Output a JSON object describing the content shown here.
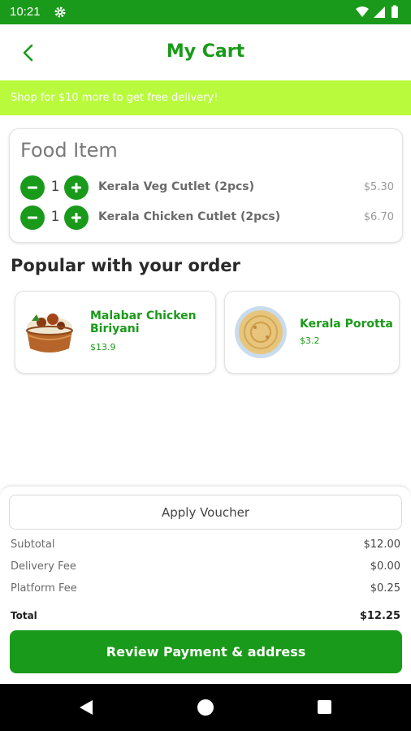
{
  "status_bar": {
    "time": "10:21",
    "icons": [
      "gear-icon",
      "wifi-icon",
      "signal-icon",
      "battery-icon"
    ]
  },
  "header": {
    "title": "My Cart",
    "back_icon": "chevron-left-icon"
  },
  "promo": {
    "text": "Shop for $10 more to get free delivery!"
  },
  "cart": {
    "heading": "Food Item",
    "items": [
      {
        "qty": "1",
        "name": "Kerala Veg Cutlet (2pcs)",
        "price": "$5.30"
      },
      {
        "qty": "1",
        "name": "Kerala Chicken Cutlet (2pcs)",
        "price": "$6.70"
      }
    ]
  },
  "popular": {
    "heading": "Popular with your order",
    "items": [
      {
        "name": "Malabar Chicken Biriyani",
        "price": "$13.9",
        "image": "biriyani-pot-image"
      },
      {
        "name": "Kerala Porotta",
        "price": "$3.2",
        "image": "porotta-plate-image"
      }
    ]
  },
  "summary": {
    "voucher_label": "Apply Voucher",
    "rows": [
      {
        "label": "Subtotal",
        "value": "$12.00"
      },
      {
        "label": "Delivery Fee",
        "value": "$0.00"
      },
      {
        "label": "Platform Fee",
        "value": "$0.25"
      }
    ],
    "total_label": "Total",
    "total_value": "$12.25",
    "cta_label": "Review Payment & address"
  },
  "colors": {
    "brand_green": "#1a9a1a",
    "promo_lime": "#b9fb3c"
  }
}
